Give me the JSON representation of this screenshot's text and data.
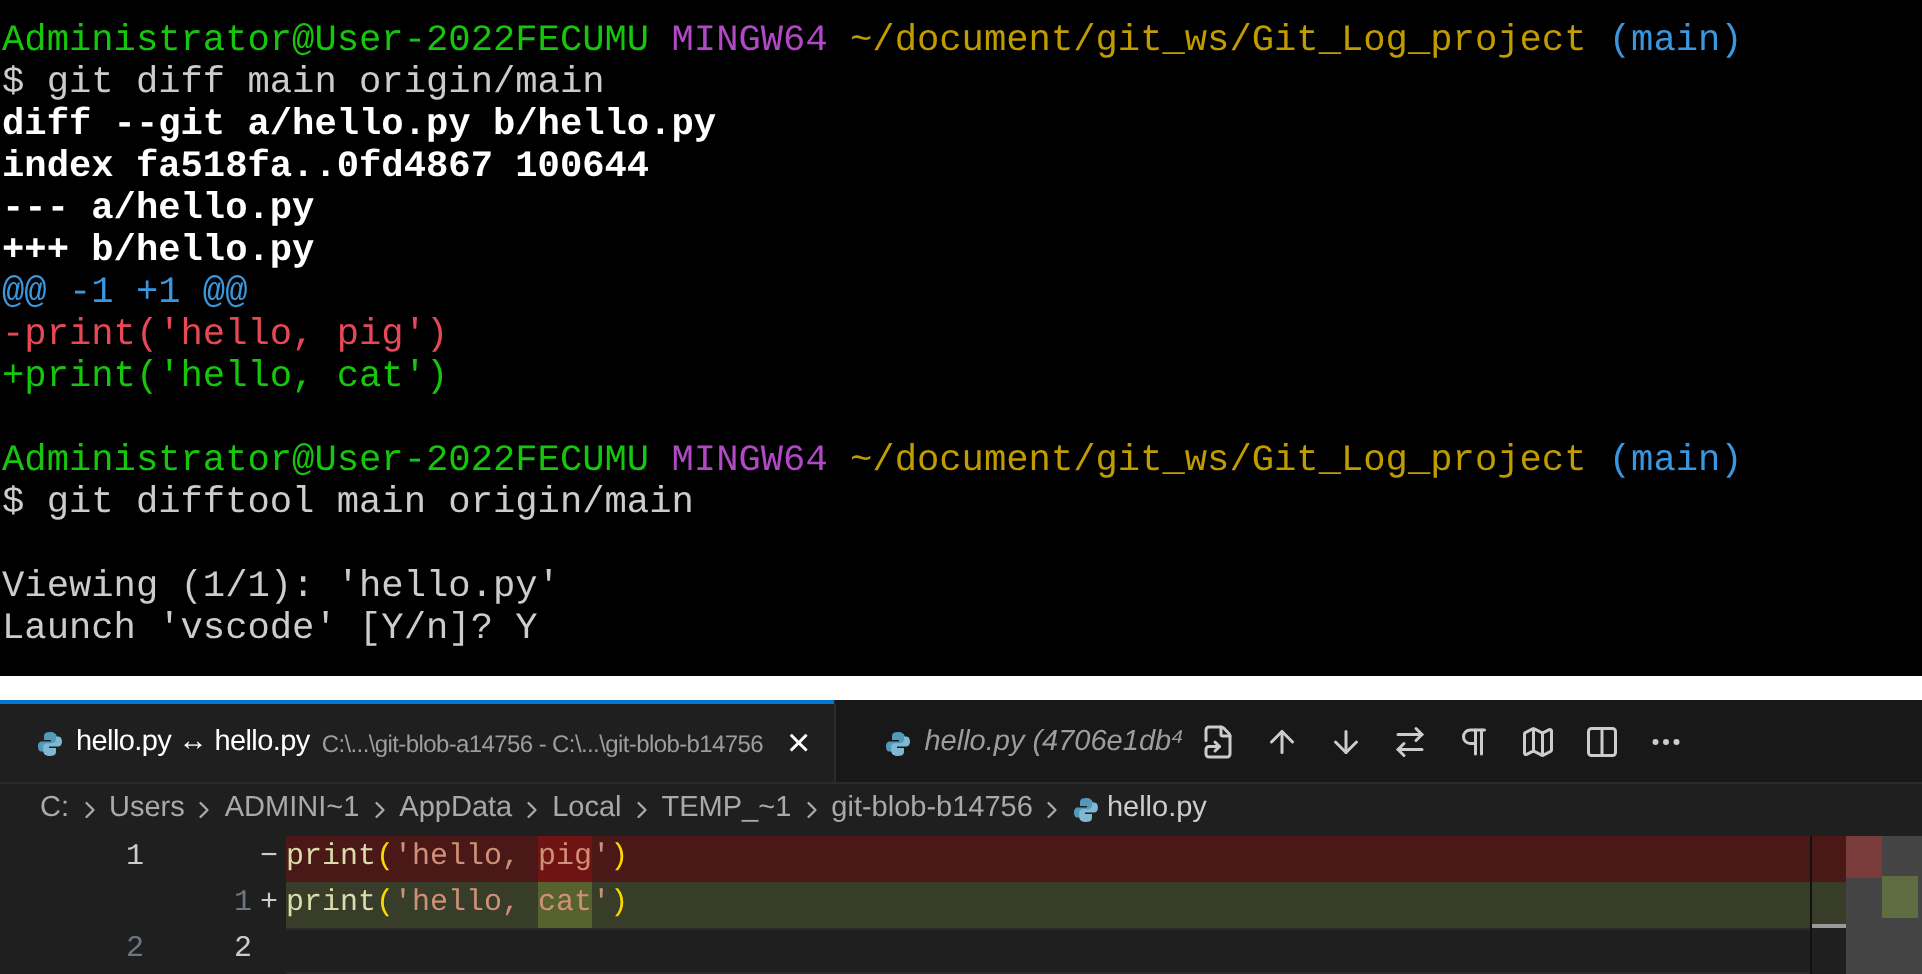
{
  "terminal": {
    "blocks": [
      {
        "lines": [
          {
            "segments": [
              {
                "text": "Administrator@User-2022FECUMU",
                "kind": "user"
              },
              {
                "text": "MINGW64",
                "kind": "host"
              },
              {
                "text": "~/document/git_ws/Git_Log_project",
                "kind": "path"
              },
              {
                "text": "(main)",
                "kind": "branch"
              }
            ]
          },
          {
            "segments": [
              {
                "text": "$ git diff main origin/main",
                "kind": "plain"
              }
            ]
          },
          {
            "segments": [
              {
                "text": "diff --git a/hello.py b/hello.py",
                "kind": "header"
              }
            ]
          },
          {
            "segments": [
              {
                "text": "index fa518fa..0fd4867 100644",
                "kind": "header"
              }
            ]
          },
          {
            "segments": [
              {
                "text": "--- a/hello.py",
                "kind": "header"
              }
            ]
          },
          {
            "segments": [
              {
                "text": "+++ b/hello.py",
                "kind": "header"
              }
            ]
          },
          {
            "segments": [
              {
                "text": "@@ -1 +1 @@",
                "kind": "hunk"
              }
            ]
          },
          {
            "segments": [
              {
                "text": "-print('hello, pig')",
                "kind": "removed"
              }
            ]
          },
          {
            "segments": [
              {
                "text": "+print('hello, cat')",
                "kind": "added"
              }
            ]
          }
        ]
      },
      {
        "lines": [
          {
            "segments": [
              {
                "text": "Administrator@User-2022FECUMU",
                "kind": "user"
              },
              {
                "text": "MINGW64",
                "kind": "host"
              },
              {
                "text": "~/document/git_ws/Git_Log_project",
                "kind": "path"
              },
              {
                "text": "(main)",
                "kind": "branch"
              }
            ]
          },
          {
            "segments": [
              {
                "text": "$ git difftool main origin/main",
                "kind": "plain"
              }
            ]
          }
        ]
      },
      {
        "lines": [
          {
            "segments": [
              {
                "text": "Viewing (1/1): 'hello.py'",
                "kind": "plain"
              }
            ]
          },
          {
            "segments": [
              {
                "text": "Launch 'vscode' [Y/n]? Y",
                "kind": "plain"
              }
            ]
          }
        ]
      }
    ]
  },
  "editor": {
    "tabs": [
      {
        "title": "hello.py ↔ hello.py",
        "description": "C:\\...\\git-blob-a14756 - C:\\...\\git-blob-b14756",
        "close": "×",
        "selected": true
      },
      {
        "title": "hello.py (4706e1db⁴",
        "selected": false
      }
    ],
    "breadcrumb": [
      "C:",
      "Users",
      "ADMINI~1",
      "AppData",
      "Local",
      "TEMP_~1",
      "git-blob-b14756",
      "hello.py"
    ],
    "lines": [
      {
        "kind": "removed",
        "original": "1",
        "marker": "−",
        "tokens": [
          {
            "text": "print",
            "kind": "function",
            "changed": false
          },
          {
            "text": "(",
            "kind": "bracket",
            "changed": false
          },
          {
            "text": "'hello, ",
            "kind": "string",
            "changed": false
          },
          {
            "text": "pig",
            "kind": "string",
            "changed": true
          },
          {
            "text": "'",
            "kind": "string",
            "changed": false
          },
          {
            "text": ")",
            "kind": "bracket",
            "changed": false
          }
        ]
      },
      {
        "kind": "added",
        "modified": "1",
        "marker": "+",
        "tokens": [
          {
            "text": "print",
            "kind": "function",
            "changed": false
          },
          {
            "text": "(",
            "kind": "bracket",
            "changed": false
          },
          {
            "text": "'hello, ",
            "kind": "string",
            "changed": false
          },
          {
            "text": "cat",
            "kind": "string",
            "changed": true
          },
          {
            "text": "'",
            "kind": "string",
            "changed": false
          },
          {
            "text": ")",
            "kind": "bracket",
            "changed": false
          }
        ]
      },
      {
        "kind": "unchanged",
        "original": "2",
        "modified": "2"
      }
    ]
  }
}
